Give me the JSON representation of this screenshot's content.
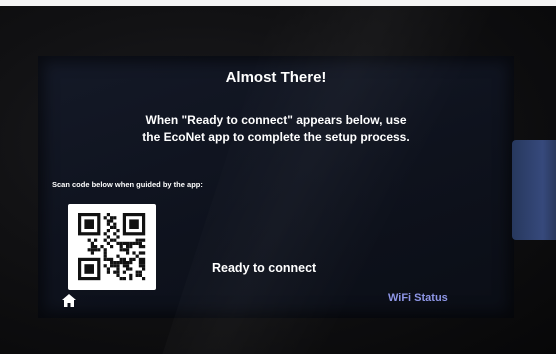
{
  "screen": {
    "title": "Almost There!",
    "instruction_line1": "When \"Ready to connect\" appears below, use",
    "instruction_line2": "the EcoNet app to complete the setup process.",
    "scan_label": "Scan code below when guided by the app:",
    "status_text": "Ready to connect",
    "wifi_status_label": "WiFi Status"
  },
  "icons": {
    "home": "home-icon",
    "qr": "qr-code"
  },
  "colors": {
    "screen_background": "#10141f",
    "text": "#ffffff",
    "wifi_status": "#8e96e6"
  }
}
